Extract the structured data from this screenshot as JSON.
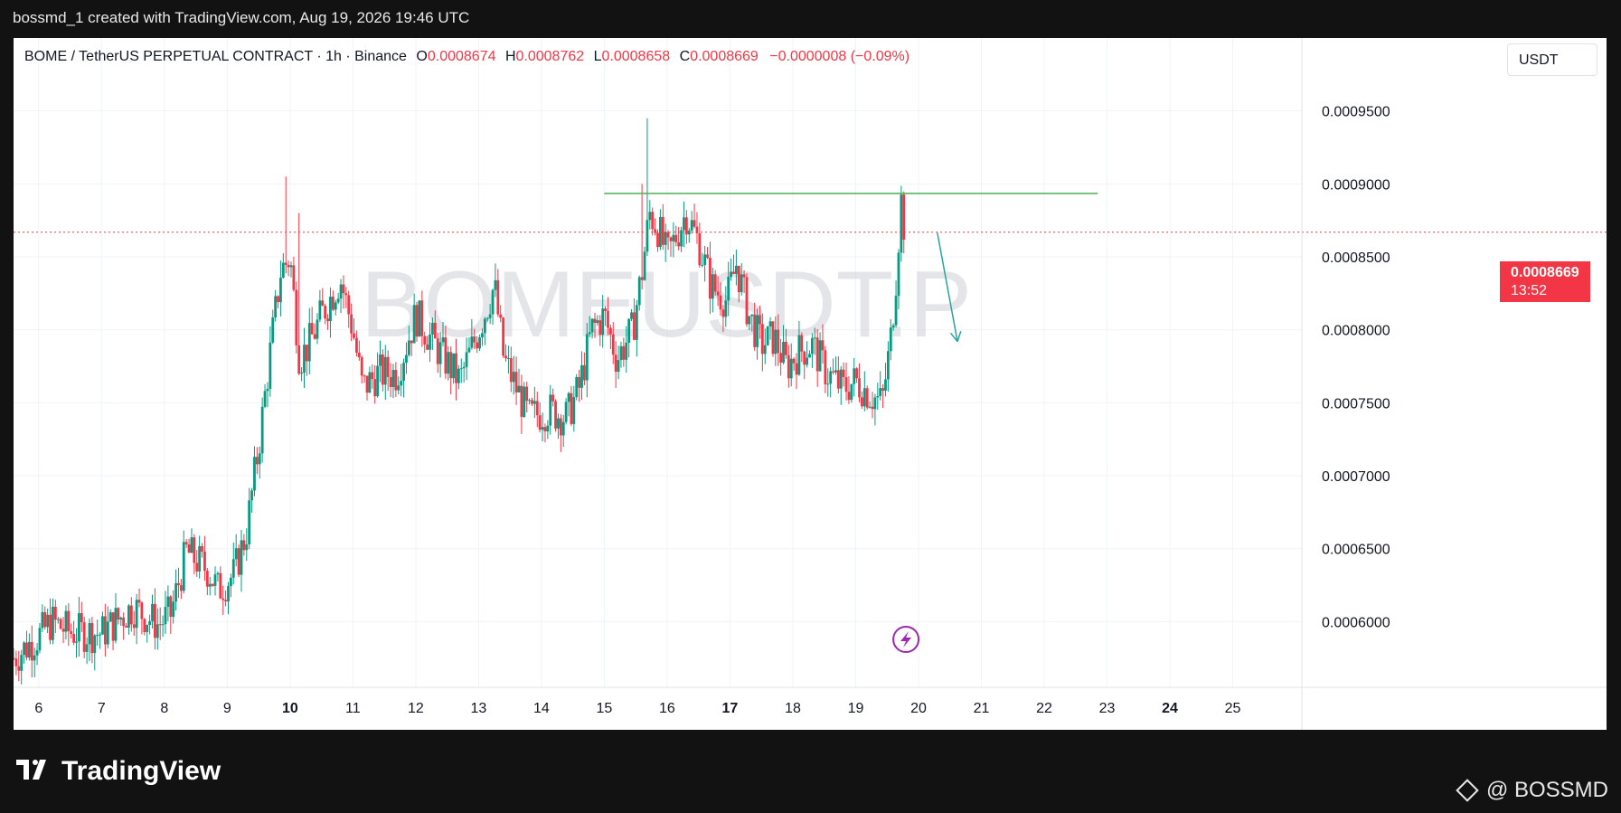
{
  "header": {
    "caption": "bossmd_1 created with TradingView.com, Aug 19, 2026 19:46 UTC"
  },
  "legend": {
    "symbol": "BOME / TetherUS PERPETUAL CONTRACT · 1h · Binance",
    "o_label": "O",
    "o": "0.0008674",
    "h_label": "H",
    "h": "0.0008762",
    "l_label": "L",
    "l": "0.0008658",
    "c_label": "C",
    "c": "0.0008669",
    "change": "−0.0000008 (−0.09%)"
  },
  "currency": "USDT",
  "watermark": "BOMEUSDT.P",
  "last_price": {
    "price": "0.0008669",
    "countdown": "13:52"
  },
  "footer": {
    "logo": "TradingView",
    "credit": "@ BOSSMD"
  },
  "colors": {
    "up": "#089981",
    "down": "#f23645",
    "level": "#4caf50",
    "arrow": "#26a69a",
    "flash": "#9c27b0"
  },
  "chart_data": {
    "type": "candlestick",
    "title": "BOME / TetherUS PERPETUAL CONTRACT · 1h · Binance",
    "xlabel": "",
    "ylabel": "",
    "y_ticks": [
      "0.0006000",
      "0.0006500",
      "0.0007000",
      "0.0007500",
      "0.0008000",
      "0.0008500",
      "0.0009000",
      "0.0009500"
    ],
    "x_ticks": [
      "6",
      "7",
      "8",
      "9",
      "10",
      "11",
      "12",
      "13",
      "14",
      "15",
      "16",
      "17",
      "18",
      "19",
      "20",
      "21",
      "22",
      "23",
      "24",
      "25"
    ],
    "ylim": [
      0.000555,
      0.001
    ],
    "x_range": [
      5.6,
      26.1
    ],
    "bold_ticks": [
      "10",
      "17",
      "24"
    ],
    "ohlc_anchors": [
      {
        "x": 5.6,
        "p": 0.000575
      },
      {
        "x": 6.0,
        "p": 0.00059
      },
      {
        "x": 6.2,
        "p": 0.0006
      },
      {
        "x": 6.5,
        "p": 0.000593
      },
      {
        "x": 7.0,
        "p": 0.000592
      },
      {
        "x": 7.5,
        "p": 0.00061
      },
      {
        "x": 7.9,
        "p": 0.000598
      },
      {
        "x": 8.1,
        "p": 0.000605
      },
      {
        "x": 8.35,
        "p": 0.000648
      },
      {
        "x": 8.7,
        "p": 0.000635
      },
      {
        "x": 8.85,
        "p": 0.000622
      },
      {
        "x": 9.1,
        "p": 0.000632
      },
      {
        "x": 9.3,
        "p": 0.00066
      },
      {
        "x": 9.5,
        "p": 0.00072
      },
      {
        "x": 9.7,
        "p": 0.00079
      },
      {
        "x": 9.85,
        "p": 0.00084
      },
      {
        "x": 10.0,
        "p": 0.00085
      },
      {
        "x": 10.15,
        "p": 0.00078
      },
      {
        "x": 10.3,
        "p": 0.00079
      },
      {
        "x": 10.5,
        "p": 0.00081
      },
      {
        "x": 10.8,
        "p": 0.000835
      },
      {
        "x": 11.0,
        "p": 0.0008
      },
      {
        "x": 11.15,
        "p": 0.00076
      },
      {
        "x": 11.4,
        "p": 0.00077
      },
      {
        "x": 11.7,
        "p": 0.00077
      },
      {
        "x": 12.0,
        "p": 0.00081
      },
      {
        "x": 12.3,
        "p": 0.00079
      },
      {
        "x": 12.7,
        "p": 0.000765
      },
      {
        "x": 13.0,
        "p": 0.0008
      },
      {
        "x": 13.25,
        "p": 0.00083
      },
      {
        "x": 13.4,
        "p": 0.00078
      },
      {
        "x": 13.6,
        "p": 0.00076
      },
      {
        "x": 13.8,
        "p": 0.00074
      },
      {
        "x": 14.1,
        "p": 0.000745
      },
      {
        "x": 14.4,
        "p": 0.00074
      },
      {
        "x": 14.6,
        "p": 0.00076
      },
      {
        "x": 14.8,
        "p": 0.0008
      },
      {
        "x": 15.0,
        "p": 0.00081
      },
      {
        "x": 15.2,
        "p": 0.00078
      },
      {
        "x": 15.45,
        "p": 0.0008
      },
      {
        "x": 15.6,
        "p": 0.00084
      },
      {
        "x": 15.72,
        "p": 0.00088
      },
      {
        "x": 15.85,
        "p": 0.00087
      },
      {
        "x": 16.0,
        "p": 0.00085
      },
      {
        "x": 16.3,
        "p": 0.00088
      },
      {
        "x": 16.5,
        "p": 0.00086
      },
      {
        "x": 16.7,
        "p": 0.00083
      },
      {
        "x": 16.95,
        "p": 0.00082
      },
      {
        "x": 17.1,
        "p": 0.000845
      },
      {
        "x": 17.3,
        "p": 0.00081
      },
      {
        "x": 17.5,
        "p": 0.00079
      },
      {
        "x": 17.7,
        "p": 0.000795
      },
      {
        "x": 17.9,
        "p": 0.000775
      },
      {
        "x": 18.1,
        "p": 0.000785
      },
      {
        "x": 18.3,
        "p": 0.00079
      },
      {
        "x": 18.55,
        "p": 0.00077
      },
      {
        "x": 18.8,
        "p": 0.00076
      },
      {
        "x": 19.0,
        "p": 0.000765
      },
      {
        "x": 19.25,
        "p": 0.000755
      },
      {
        "x": 19.42,
        "p": 0.00075
      },
      {
        "x": 19.55,
        "p": 0.00079
      },
      {
        "x": 19.65,
        "p": 0.00084
      },
      {
        "x": 19.72,
        "p": 0.00089
      },
      {
        "x": 19.78,
        "p": 0.000867
      }
    ],
    "resistance": {
      "price": 0.0008935,
      "x_start": 15.0,
      "x_end": 22.85
    },
    "last_price_line": 0.0008669,
    "arrow": {
      "x1": 20.3,
      "y1": 0.0008665,
      "x2": 20.62,
      "y2": 0.000792
    },
    "flash_marker": {
      "x": 19.8
    }
  }
}
